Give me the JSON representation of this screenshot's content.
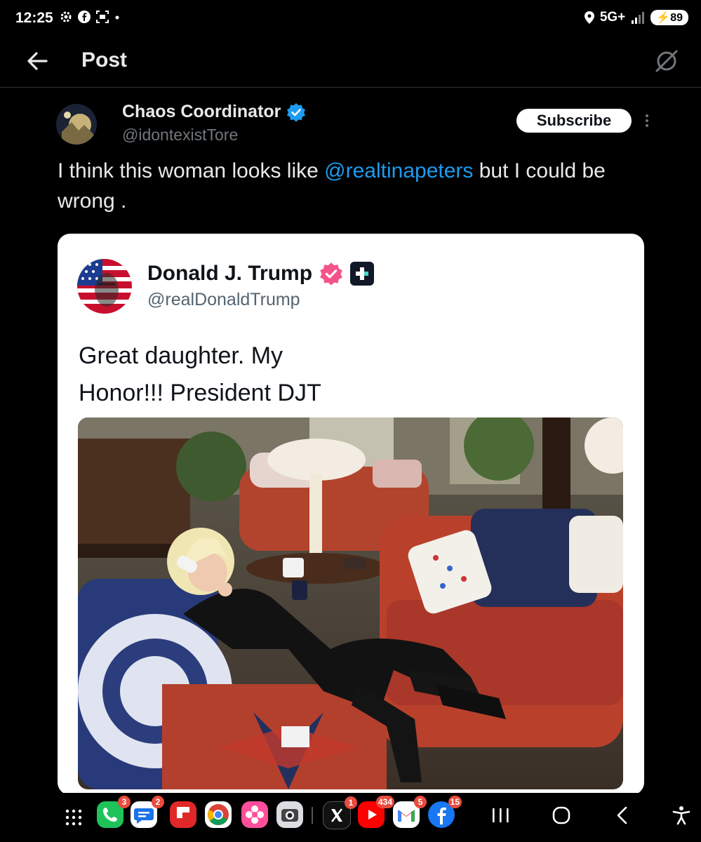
{
  "status_bar": {
    "time": "12:25",
    "network": "5G+",
    "battery": "89"
  },
  "header": {
    "title": "Post"
  },
  "post": {
    "author_name": "Chaos Coordinator",
    "author_handle": "@idontexistTore",
    "subscribe_label": "Subscribe",
    "text_before": "I think this woman looks like ",
    "mention": "@realtinapeters",
    "text_after": " but I could be wrong ."
  },
  "quoted": {
    "author_name": "Donald J. Trump",
    "author_handle": "@realDonaldTrump",
    "text_line1": "Great daughter. My",
    "text_line2": "Honor!!! President DJT"
  },
  "nav_badges": {
    "phone": "3",
    "messages": "2",
    "x": "1",
    "youtube": "434",
    "gmail": "5",
    "facebook": "15"
  },
  "colors": {
    "accent": "#1d9bf0",
    "background": "#000000",
    "card": "#ffffff",
    "verified_pink": "#f4538a"
  }
}
